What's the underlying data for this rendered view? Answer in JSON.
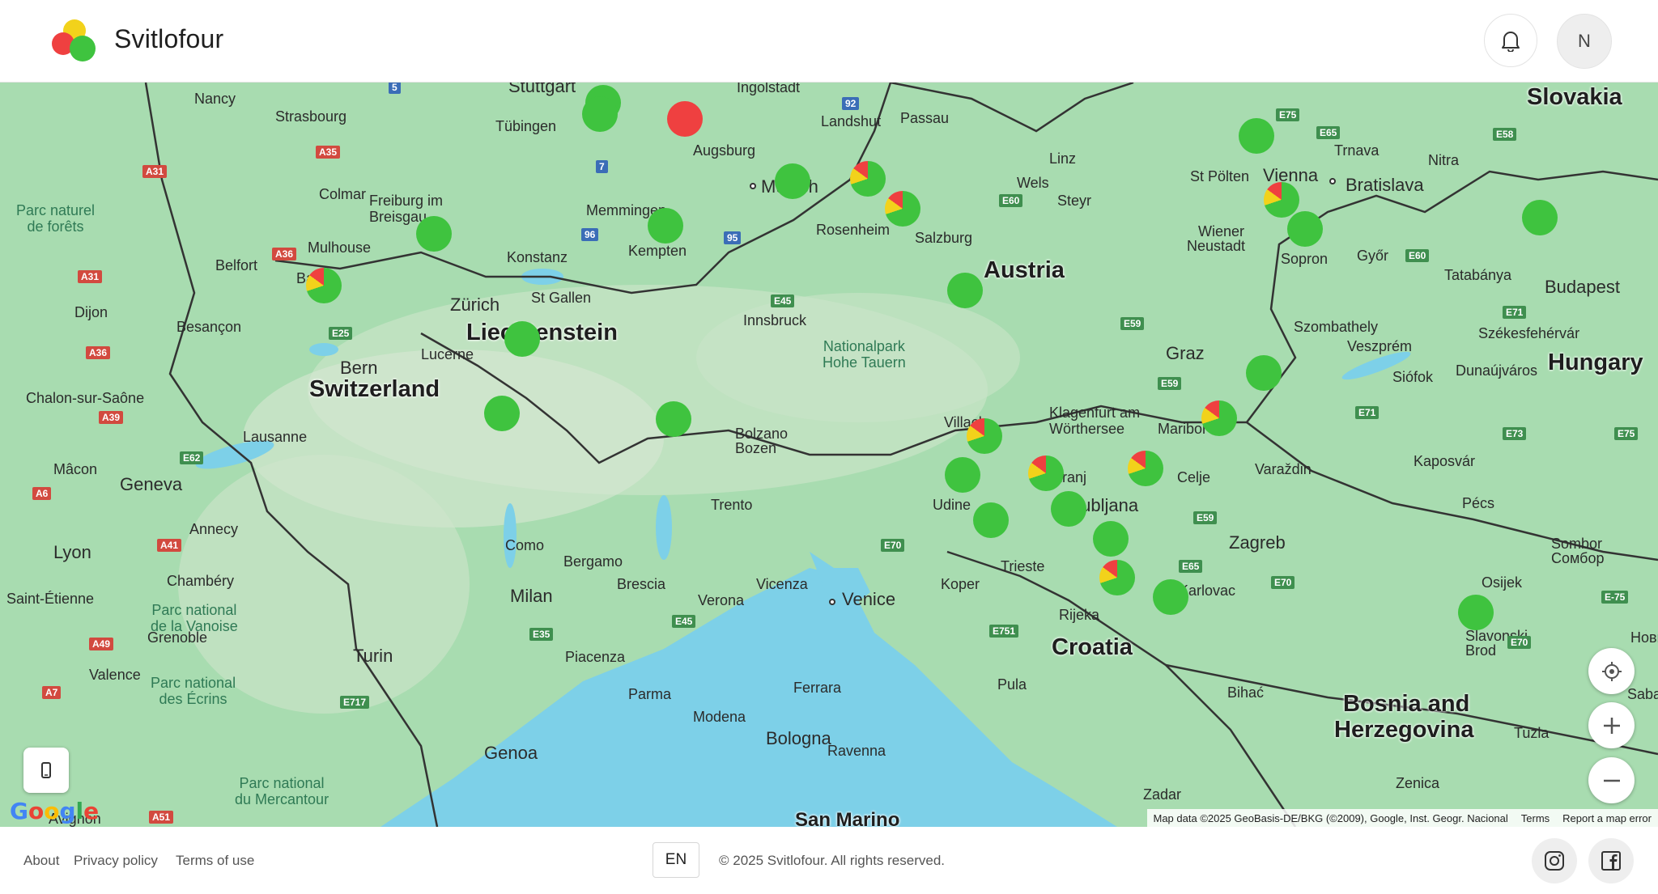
{
  "app": {
    "title": "Svitlofour"
  },
  "header": {
    "avatar_initial": "N"
  },
  "map": {
    "countries": [
      "Slovakia",
      "Austria",
      "Hungary",
      "Liechtenstein",
      "Switzerland",
      "Croatia",
      "Bosnia and",
      "Herzegovina",
      "San Marino"
    ],
    "cities": [
      "Stuttgart",
      "Ingolstadt",
      "Nancy",
      "Strasbourg",
      "Tübingen",
      "Augsburg",
      "Landshut",
      "Passau",
      "Vienna",
      "Trnava",
      "Nitra",
      "Bratislava",
      "Munich",
      "Linz",
      "St Pölten",
      "Colmar",
      "Freiburg im",
      "Breisgau",
      "Memmingen",
      "Rosenheim",
      "Wels",
      "Steyr",
      "Salzburg",
      "Wiener",
      "Neustadt",
      "Győr",
      "Tatabánya",
      "Budapest",
      "Belfort",
      "Mulhouse",
      "Konstanz",
      "Kempten",
      "Basel",
      "Zürich",
      "St Gallen",
      "Sopron",
      "Dijon",
      "Besançon",
      "Innsbruck",
      "Szombathely",
      "Székesfehérvár",
      "Veszprém",
      "Bern",
      "Lucerne",
      "Graz",
      "Siófok",
      "Dunaújváros",
      "Chalon-sur-Saône",
      "Klagenfurt am",
      "Wörthersee",
      "Villach",
      "Maribor",
      "Lausanne",
      "Bolzano",
      "Bozen",
      "Mâcon",
      "Geneva",
      "Varaždin",
      "Kaposvár",
      "Kranj",
      "Celje",
      "Ljubljana",
      "Udine",
      "Trento",
      "Pécs",
      "Annecy",
      "Lyon",
      "Como",
      "Bergamo",
      "Zagreb",
      "Sombor",
      "Сомбор",
      "Chambéry",
      "Brescia",
      "Vicenza",
      "Trieste",
      "Koper",
      "Karlovac",
      "Osijek",
      "Saint-Étienne",
      "Milan",
      "Verona",
      "Venice",
      "Rijeka",
      "Slavonski",
      "Brod",
      "Grenoble",
      "Turin",
      "Piacenza",
      "Valence",
      "Parma",
      "Ferrara",
      "Pula",
      "Bihać",
      "Modena",
      "Tuzla",
      "Bologna",
      "Genoa",
      "Ravenna",
      "Zenica",
      "Zadar",
      "Avignon",
      "Sabac",
      "Нови",
      "Ljubljana"
    ],
    "parks": [
      "Parc naturel\nde forêts",
      "Nationalpark\nHohe Tauern",
      "Parc national\nde la Vanoise",
      "Parc national\ndes Écrins",
      "Parc national\ndu Mercantour"
    ],
    "roads": [
      "5",
      "92",
      "E75",
      "E65",
      "E58",
      "A35",
      "A31",
      "7",
      "E60",
      "96",
      "95",
      "A36",
      "E60",
      "A31",
      "E45",
      "E59",
      "E71",
      "A36",
      "E25",
      "E59",
      "A39",
      "E71",
      "E73",
      "E75",
      "E62",
      "A6",
      "E59",
      "A41",
      "E70",
      "E65",
      "E70",
      "E-75",
      "E751",
      "E35",
      "E45",
      "E70",
      "A49",
      "A7",
      "E717",
      "A51"
    ],
    "attribution": "Map data ©2025 GeoBasis-DE/BKG (©2009), Google, Inst. Geogr. Nacional",
    "terms": "Terms",
    "report": "Report a map error",
    "google": "Google",
    "markers": [
      {
        "status": "green"
      },
      {
        "status": "green"
      },
      {
        "status": "red"
      },
      {
        "status": "green"
      },
      {
        "status": "mixed"
      },
      {
        "status": "mixed"
      },
      {
        "status": "green"
      },
      {
        "status": "green"
      },
      {
        "status": "mixed"
      },
      {
        "status": "green"
      },
      {
        "status": "green"
      },
      {
        "status": "mixed"
      },
      {
        "status": "green"
      },
      {
        "status": "green"
      },
      {
        "status": "green"
      },
      {
        "status": "green"
      },
      {
        "status": "mixed"
      },
      {
        "status": "green"
      },
      {
        "status": "green"
      },
      {
        "status": "mixed"
      },
      {
        "status": "mixed"
      },
      {
        "status": "mixed"
      },
      {
        "status": "green"
      },
      {
        "status": "green"
      },
      {
        "status": "green"
      },
      {
        "status": "green"
      },
      {
        "status": "mixed"
      },
      {
        "status": "green"
      },
      {
        "status": "green"
      }
    ],
    "colors": {
      "green": "#3fc33f",
      "red": "#ef4040",
      "yellow": "#f2d21b",
      "water": "#7dd0e8",
      "land": "#a8dcb0"
    }
  },
  "footer": {
    "about": "About",
    "privacy": "Privacy policy",
    "terms": "Terms of use",
    "language": "EN",
    "copyright": "© 2025 Svitlofour. All rights reserved."
  },
  "icons": [
    "bell-icon",
    "instagram-icon",
    "facebook-icon",
    "locate-icon",
    "plus-icon",
    "minus-icon",
    "mobile-icon"
  ]
}
